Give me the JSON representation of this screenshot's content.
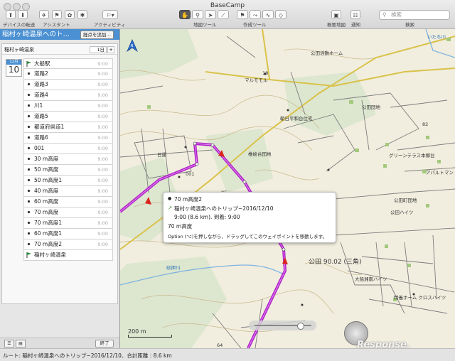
{
  "window": {
    "title": "BaseCamp"
  },
  "toolbar": {
    "device_transfer_label": "デバイスの転送",
    "assistant_label": "アシスタント",
    "activity_label": "アクティビティ",
    "map_tools_label": "地図ツール",
    "create_tools_label": "作成ツール",
    "overview_map_label": "概要地図",
    "notify_label": "通知",
    "search_label": "検索",
    "search_placeholder": "検索"
  },
  "sidebar": {
    "trip_title": "稲村ヶ崎温泉へのト…",
    "add_via_button": "経点を追加…",
    "panel_title": "稲村ヶ崎温泉",
    "day_select": "1日",
    "day_plus": "+",
    "calendar": {
      "month": "12月",
      "day": "10"
    },
    "waypoints": [
      {
        "name": "大船駅",
        "time": "9:00",
        "kind": "flag"
      },
      {
        "name": "道路2",
        "time": "9:00",
        "kind": "dot"
      },
      {
        "name": "道路3",
        "time": "9:00",
        "kind": "dot"
      },
      {
        "name": "道路4",
        "time": "9:00",
        "kind": "dot"
      },
      {
        "name": "川1",
        "time": "9:00",
        "kind": "dot"
      },
      {
        "name": "道路5",
        "time": "9:00",
        "kind": "dot"
      },
      {
        "name": "都道府県道1",
        "time": "9:00",
        "kind": "dot"
      },
      {
        "name": "道路6",
        "time": "9:00",
        "kind": "dot"
      },
      {
        "name": "001",
        "time": "9:00",
        "kind": "dot"
      },
      {
        "name": "30 m高度",
        "time": "9:00",
        "kind": "dot"
      },
      {
        "name": "50 m高度",
        "time": "9:00",
        "kind": "dot"
      },
      {
        "name": "50 m高度1",
        "time": "9:00",
        "kind": "dot"
      },
      {
        "name": "40 m高度",
        "time": "9:00",
        "kind": "dot"
      },
      {
        "name": "60 m高度",
        "time": "9:00",
        "kind": "dot"
      },
      {
        "name": "70 m高度",
        "time": "9:00",
        "kind": "dot"
      },
      {
        "name": "70 m高度1",
        "time": "9:00",
        "kind": "dot"
      },
      {
        "name": "60 m高度1",
        "time": "9:00",
        "kind": "dot"
      },
      {
        "name": "70 m高度2",
        "time": "9:00",
        "kind": "dot"
      },
      {
        "name": "稲村ヶ崎温泉",
        "time": "",
        "kind": "flag"
      }
    ],
    "done_button": "終了"
  },
  "map": {
    "labels": {
      "marumoru": "マルモモル",
      "shikishi": "朝日平和台住宅",
      "koda": "公田",
      "yamagata": "椎絵台団地",
      "hitachi": "日通",
      "n001": "001",
      "n85": "85",
      "n82": "82",
      "n18": "18",
      "tenchi": "天池台",
      "green": "グリーンテラス本郷台",
      "ayase_ap": "アパルトマン",
      "koda_home": "公田ハイツ",
      "elev": "公田 90.02 (三角)",
      "ofuna_high": "大船湘南ハイツ",
      "tokuyo": "特養ホーム クロスハイツ",
      "sunagawa": "砂押川",
      "road_top": "いたち川",
      "sanitarium": "公田活動ホーム",
      "n64": "64",
      "public": "公田団地",
      "koda_school": "公田町団地"
    },
    "scale_label": "200 m",
    "watermark": "Response."
  },
  "tooltip": {
    "point_name": "70 m高度2",
    "trip": "稲村ヶ崎温泉へのトリップ~2016/12/10",
    "timing": "9:00 (8.6 km). 到着: 9:00",
    "altitude": "70 m高度",
    "hint": "Option (⌥)を押しながら、ドラッグしてこのウェイポイントを移動します。"
  },
  "status": {
    "text": "ルート: 稲村ヶ崎温泉へのトリップ~2016/12/10、合計距離 : 8.6 km"
  },
  "colors": {
    "route": "#b021c9",
    "trip_header": "#4a90d2",
    "map_bg": "#f1eedf"
  }
}
